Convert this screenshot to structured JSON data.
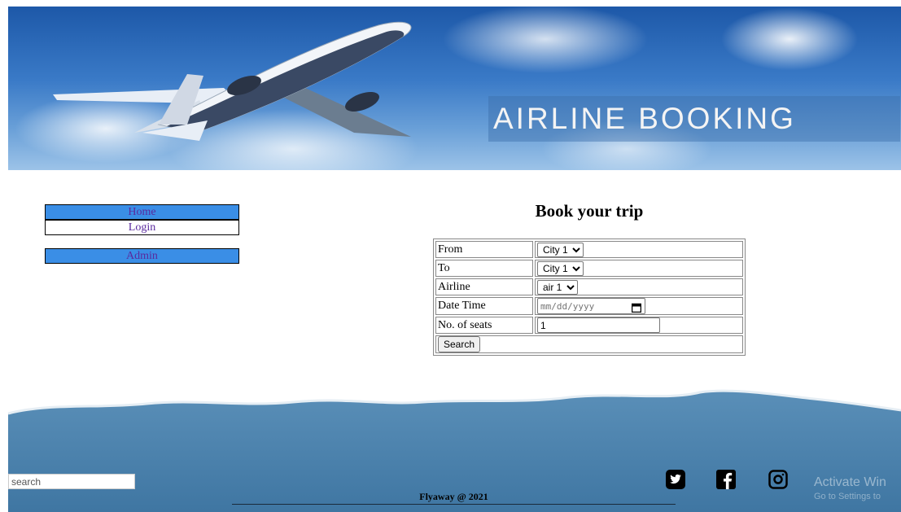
{
  "header": {
    "title": "AIRLINE BOOKING"
  },
  "nav": {
    "home": "Home",
    "login": "Login",
    "admin": "Admin"
  },
  "form": {
    "title": "Book your trip",
    "from_label": "From",
    "from_value": "City 1",
    "to_label": "To",
    "to_value": "City 1",
    "airline_label": "Airline",
    "airline_value": "air 1",
    "datetime_label": "Date Time",
    "datetime_placeholder": "mm/dd/yyyy",
    "seats_label": "No. of seats",
    "seats_value": "1",
    "search_button": "Search"
  },
  "footer": {
    "search_placeholder": "search",
    "copyright": "Flyaway @ 2021",
    "social": [
      "twitter-icon",
      "facebook-icon",
      "instagram-icon"
    ]
  },
  "watermark": {
    "line1": "Activate Win",
    "line2": "Go to Settings to"
  },
  "colors": {
    "nav_blue": "#3a8ee6",
    "nav_text": "#5a2a9e",
    "footer_blue": "#4a7fa8"
  }
}
